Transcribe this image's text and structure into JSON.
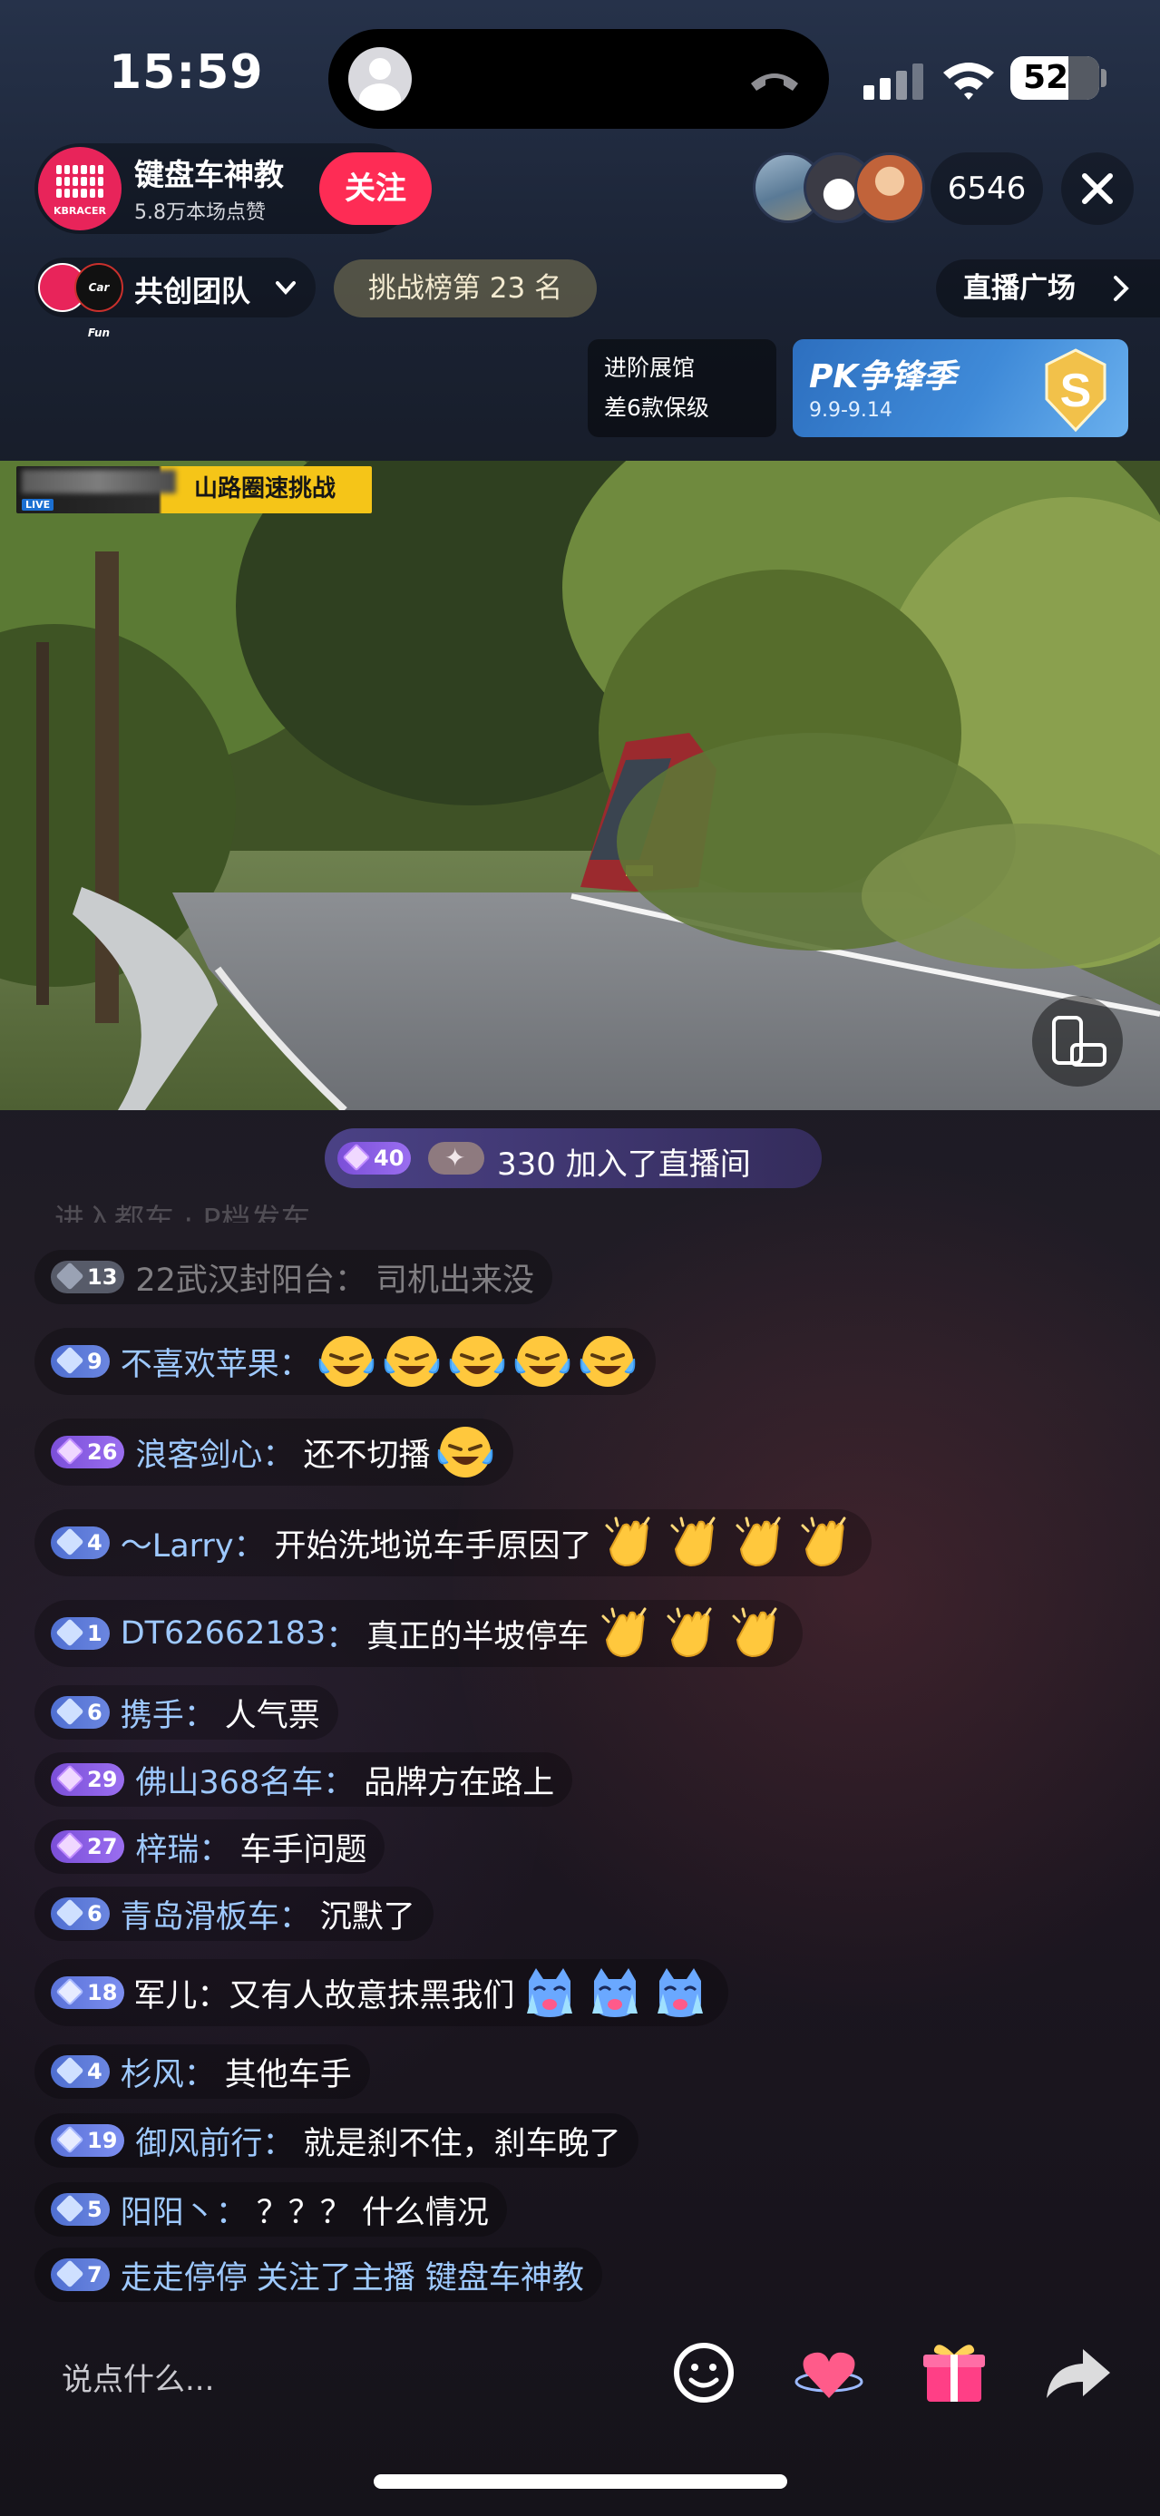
{
  "status_bar": {
    "time": "15:59",
    "battery": "52"
  },
  "host": {
    "name": "键盘车神教",
    "likes": "5.8万本场点赞",
    "logo_text": "KBRACER",
    "follow_label": "关注"
  },
  "viewers": {
    "count": "6546"
  },
  "team": {
    "label": "共创团队",
    "partner_logo": "Car Fun"
  },
  "rank": {
    "label": "挑战榜第 23 名"
  },
  "plaza": {
    "label": "直播广场"
  },
  "upgrade": {
    "line1": "进阶展馆",
    "line2": "差6款保级"
  },
  "pk": {
    "title": "PK争锋季",
    "date": "9.9-9.14"
  },
  "video": {
    "banner_title": "山路圈速挑战",
    "live_badge": "LIVE"
  },
  "join_notice": {
    "level": "40",
    "text": "330 加入了直播间"
  },
  "faded_line": "进入都车 · P档发车",
  "comments": [
    {
      "level": "13",
      "badge": "gray",
      "user": "22武汉封阳台",
      "message": "司机出来没",
      "faded": true
    },
    {
      "level": "9",
      "badge": "blue",
      "user": "不喜欢苹果",
      "message": "",
      "emojis": [
        "crying-laugh",
        "crying-laugh",
        "crying-laugh",
        "crying-laugh",
        "crying-laugh"
      ]
    },
    {
      "level": "26",
      "badge": "purple",
      "user": "浪客剑心",
      "message": "还不切播",
      "emojis": [
        "crying-laugh"
      ]
    },
    {
      "level": "4",
      "badge": "blue",
      "user": "～Larry",
      "message": "开始洗地说车手原因了",
      "emojis": [
        "clap",
        "clap",
        "clap",
        "clap"
      ]
    },
    {
      "level": "1",
      "badge": "blue",
      "user": "DT62662183",
      "message": "真正的半坡停车",
      "emojis": [
        "clap",
        "clap",
        "clap"
      ]
    },
    {
      "level": "6",
      "badge": "blue",
      "user": "携手",
      "message": "人气票"
    },
    {
      "level": "29",
      "badge": "purple",
      "user": "佛山368名车",
      "message": "品牌方在路上"
    },
    {
      "level": "27",
      "badge": "purple",
      "user": "梓瑞",
      "message": "车手问题"
    },
    {
      "level": "6",
      "badge": "blue",
      "user": "青岛滑板车",
      "message": "沉默了"
    },
    {
      "level": "18",
      "badge": "blue2",
      "user": "",
      "message": "军儿：又有人故意抹黑我们",
      "emojis": [
        "crying-cat",
        "crying-cat",
        "crying-cat"
      ]
    },
    {
      "level": "4",
      "badge": "blue",
      "user": "杉风",
      "message": "其他车手"
    },
    {
      "level": "19",
      "badge": "blue2",
      "user": "御风前行",
      "message": "就是刹不住，刹车晚了"
    },
    {
      "level": "5",
      "badge": "blue",
      "user": "阳阳丶",
      "message": "？？？ 什么情况"
    },
    {
      "level": "7",
      "badge": "blue",
      "user": "走走停停",
      "message": "关注了主播 键盘车神教",
      "follow_event": true
    }
  ],
  "input": {
    "placeholder": "说点什么..."
  },
  "colors": {
    "follow": "#fe2c55",
    "username": "#9ec9ff",
    "pk_card": "#3f8ad8"
  }
}
